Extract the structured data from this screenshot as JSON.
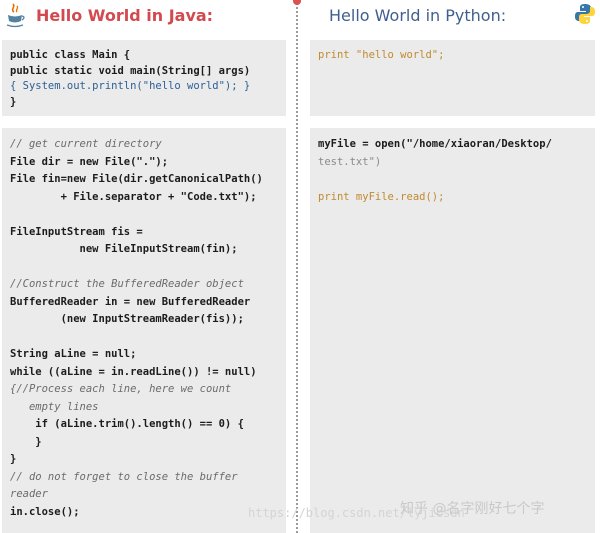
{
  "java": {
    "title": "Hello World in Java:",
    "hello_code": [
      "public class Main {",
      "public static void main(String[] args)",
      "{ System.out.println(\"hello world\"); }",
      "}"
    ],
    "file_code": [
      "// get current directory",
      "File dir = new File(\".\");",
      "File fin=new File(dir.getCanonicalPath()",
      "        + File.separator + \"Code.txt\");",
      "",
      "FileInputStream fis =",
      "           new FileInputStream(fin);",
      "",
      "//Construct the BufferedReader object",
      "BufferedReader in = new BufferedReader",
      "        (new InputStreamReader(fis));",
      "",
      "String aLine = null;",
      "while ((aLine = in.readLine()) != null)",
      "{//Process each line, here we count",
      "   empty lines",
      "    if (aLine.trim().length() == 0) {",
      "    }",
      "}",
      "// do not forget to close the buffer",
      "reader",
      "in.close();"
    ]
  },
  "python": {
    "title": "Hello World in Python:",
    "hello_code": [
      "print \"hello world\";"
    ],
    "file_code": [
      "myFile = open(\"/home/xiaoran/Desktop/",
      "test.txt\")",
      "",
      "print myFile.read();"
    ]
  },
  "watermark": {
    "text": "知乎 @名字刚好七个字",
    "url": "https://blog.csdn.net/lyjicsdn"
  },
  "icons": {
    "java": "java-coffee-cup-icon",
    "python": "python-snake-icon"
  },
  "colors": {
    "java_title": "#d3494e",
    "python_title": "#3f5f8f",
    "panel_bg": "#ebebeb"
  }
}
